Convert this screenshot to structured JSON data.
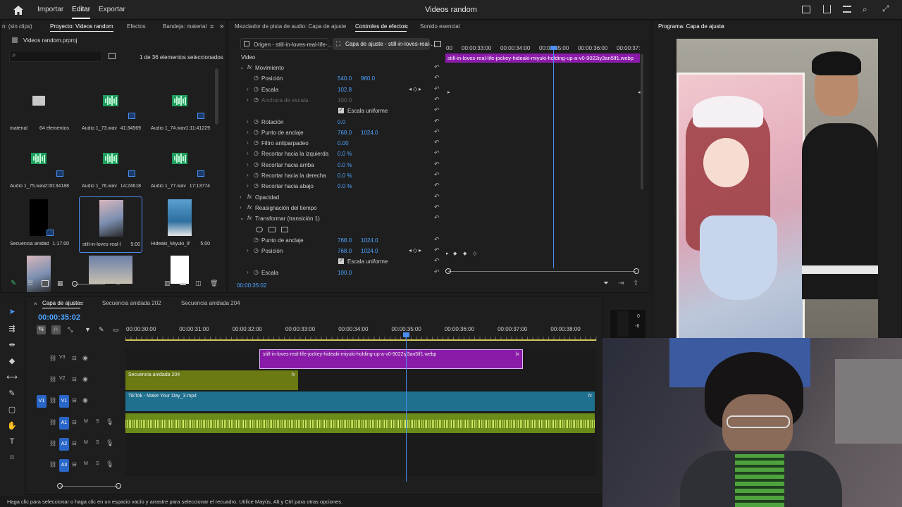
{
  "app": {
    "menu": [
      "Importar",
      "Editar",
      "Exportar"
    ],
    "active_menu": "Editar",
    "title": "Videos random"
  },
  "project_panel": {
    "tabs": [
      "n: (sin clips)",
      "Proyecto: Videos random",
      "Efectos",
      "Bandeja: material"
    ],
    "active_tab": "Proyecto: Videos random",
    "file": "Videos random.prproj",
    "selection_count": "1 de 36 elementos seleccionados",
    "items": [
      {
        "name": "material",
        "meta": "64 elementos",
        "kind": "folder"
      },
      {
        "name": "Audio 1_73.wav",
        "meta": "41:34569",
        "kind": "audio"
      },
      {
        "name": "Audio 1_74.wav",
        "meta": "1:11:41229",
        "kind": "audio"
      },
      {
        "name": "Audio 1_75.wav",
        "meta": "2:00:34188",
        "kind": "audio"
      },
      {
        "name": "Audio 1_76.wav",
        "meta": "14:24618",
        "kind": "audio"
      },
      {
        "name": "Audio 1_77.wav",
        "meta": "17:13774",
        "kind": "audio"
      },
      {
        "name": "Secuencia anidad...",
        "meta": "1:17:00",
        "kind": "sequence"
      },
      {
        "name": "still-in-loves-real-life-...",
        "meta": "5:00",
        "kind": "image-selected"
      },
      {
        "name": "Hideaki_Miyuki_IM...",
        "meta": "5:00",
        "kind": "image"
      },
      {
        "name": "",
        "meta": "",
        "kind": "image"
      },
      {
        "name": "",
        "meta": "",
        "kind": "image"
      },
      {
        "name": "",
        "meta": "",
        "kind": "white"
      }
    ]
  },
  "effects_panel": {
    "tabs": [
      "Mezclador de pista de audio: Capa de ajuste",
      "Controles de efectos",
      "Sonido esencial"
    ],
    "active_tab": "Controles de efectos",
    "source_tab": "Origen - still-in-loves-real-life-...",
    "target_tab": "Capa de ajuste - still-in-loves-real-...",
    "section_video": "Video",
    "clip_name": "still-in-loves-real-life-jockey-hideaki-miyuki-holding-up-a-v0-9022iy3an5lf1.webp",
    "ruler": [
      "00",
      "00:00:33:00",
      "00:00:34:00",
      "00:00:35:00",
      "00:00:36:00",
      "00:00:37:"
    ],
    "timecode": "00:00:35:02",
    "rows": [
      {
        "label": "Movimiento",
        "fx": true,
        "twirl": "v"
      },
      {
        "label": "Posición",
        "v1": "540.0",
        "v2": "960.0",
        "stopwatch": true
      },
      {
        "label": "Escala",
        "v1": "102.8",
        "stopwatch": true,
        "twirl": ">"
      },
      {
        "label": "Anchura de escala",
        "v1": "100.0",
        "stopwatch": true,
        "twirl": ">",
        "dim": true
      },
      {
        "label": "Escala uniforme",
        "checkbox": true
      },
      {
        "label": "Rotación",
        "v1": "0.0",
        "stopwatch": true,
        "twirl": ">"
      },
      {
        "label": "Punto de anclaje",
        "v1": "768.0",
        "v2": "1024.0",
        "stopwatch": true,
        "twirl": ">"
      },
      {
        "label": "Filtro antiparpadeo",
        "v1": "0.00",
        "stopwatch": true,
        "twirl": ">"
      },
      {
        "label": "Recortar hacia la izquierda",
        "v1": "0.0 %",
        "stopwatch": true,
        "twirl": ">"
      },
      {
        "label": "Recortar hacia arriba",
        "v1": "0.0 %",
        "stopwatch": true,
        "twirl": ">"
      },
      {
        "label": "Recortar hacia la derecha",
        "v1": "0.0 %",
        "stopwatch": true,
        "twirl": ">"
      },
      {
        "label": "Recortar hacia abajo",
        "v1": "0.0 %",
        "stopwatch": true,
        "twirl": ">"
      },
      {
        "label": "Opacidad",
        "fx": true,
        "twirl": ">"
      },
      {
        "label": "Reasignación del tiempo",
        "fx": true,
        "twirl": ">"
      },
      {
        "label": "Transformar (transición 1)",
        "fx": true,
        "twirl": "v"
      },
      {
        "label": "",
        "shapes": true
      },
      {
        "label": "Punto de anclaje",
        "v1": "768.0",
        "v2": "1024.0",
        "stopwatch": true
      },
      {
        "label": "Posición",
        "v1": "768.0",
        "v2": "1024.0",
        "stopwatch": true,
        "twirl": ">"
      },
      {
        "label": "Escala uniforme",
        "checkbox": true
      },
      {
        "label": "Escala",
        "v1": "100.0",
        "stopwatch": true,
        "twirl": ">"
      }
    ]
  },
  "program_monitor": {
    "title": "Programa: Capa de ajuste"
  },
  "timeline": {
    "tabs": [
      "Capa de ajuste",
      "Secuencia anidada 202",
      "Secuencia anidada 204"
    ],
    "active_tab": "Capa de ajuste",
    "timecode": "00:00:35:02",
    "ruler": [
      "00:00:30:00",
      "00:00:31:00",
      "00:00:32:00",
      "00:00:33:00",
      "00:00:34:00",
      "00:00:35:00",
      "00:00:36:00",
      "00:00:37:00",
      "00:00:38:00"
    ],
    "tracks": [
      {
        "id": "V3",
        "kind": "video"
      },
      {
        "id": "V2",
        "kind": "video"
      },
      {
        "id": "V1",
        "kind": "video",
        "target": "V1"
      },
      {
        "id": "A1",
        "kind": "audio",
        "m": "M",
        "s": "S"
      },
      {
        "id": "A2",
        "kind": "audio",
        "m": "M",
        "s": "S"
      },
      {
        "id": "A3",
        "kind": "audio",
        "m": "M",
        "s": "S"
      }
    ],
    "clips": [
      {
        "track": "V3",
        "label": "still-in-loves-real-life-jockey-hideaki-miyuki-holding-up-a-v0-9022iy3an5lf1.webp",
        "color": "#8a1ba8"
      },
      {
        "track": "V2",
        "label": "Secuencia anidada 204",
        "color": "#6b7a12"
      },
      {
        "track": "V1",
        "label": "TikTok - Make Your Day_3.mp4",
        "color": "#1f6f8e"
      }
    ],
    "fx_label": "fx",
    "meter_labels": [
      "0",
      "-6"
    ]
  },
  "status": "Haga clic para seleccionar o haga clic en un espacio vacío y arrastre para seleccionar el recuadro. Utilice Mayús, Alt y Ctrl para otras opciones."
}
